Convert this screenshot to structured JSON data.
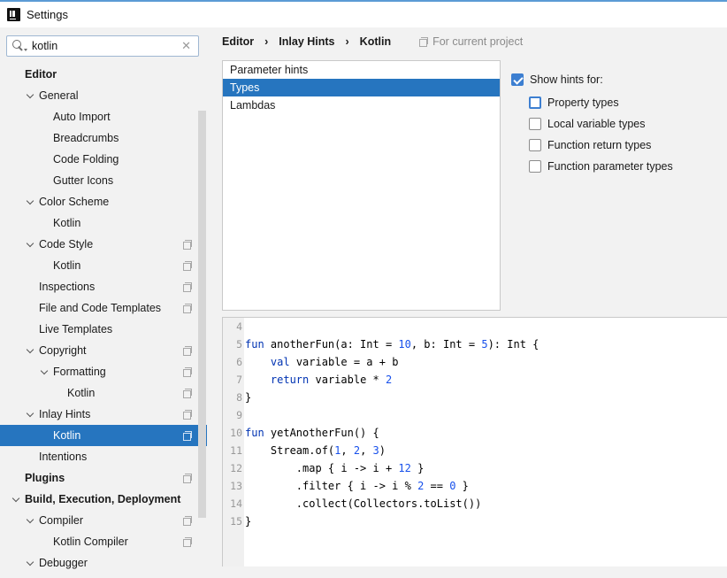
{
  "window": {
    "title": "Settings"
  },
  "search": {
    "value": "kotlin",
    "clear_glyph": "✕"
  },
  "tree": [
    {
      "label": "Editor",
      "bold": true,
      "chevron": false,
      "proj": false
    },
    {
      "label": "General",
      "bold": false,
      "chevron": true,
      "proj": false
    },
    {
      "label": "Auto Import",
      "bold": false,
      "chevron": false,
      "proj": false
    },
    {
      "label": "Breadcrumbs",
      "bold": false,
      "chevron": false,
      "proj": false
    },
    {
      "label": "Code Folding",
      "bold": false,
      "chevron": false,
      "proj": false
    },
    {
      "label": "Gutter Icons",
      "bold": false,
      "chevron": false,
      "proj": false
    },
    {
      "label": "Color Scheme",
      "bold": false,
      "chevron": true,
      "proj": false
    },
    {
      "label": "Kotlin",
      "bold": false,
      "chevron": false,
      "proj": false
    },
    {
      "label": "Code Style",
      "bold": false,
      "chevron": true,
      "proj": true
    },
    {
      "label": "Kotlin",
      "bold": false,
      "chevron": false,
      "proj": true
    },
    {
      "label": "Inspections",
      "bold": false,
      "chevron": false,
      "proj": true
    },
    {
      "label": "File and Code Templates",
      "bold": false,
      "chevron": false,
      "proj": true
    },
    {
      "label": "Live Templates",
      "bold": false,
      "chevron": false,
      "proj": false
    },
    {
      "label": "Copyright",
      "bold": false,
      "chevron": true,
      "proj": true
    },
    {
      "label": "Formatting",
      "bold": false,
      "chevron": true,
      "proj": true
    },
    {
      "label": "Kotlin",
      "bold": false,
      "chevron": false,
      "proj": true
    },
    {
      "label": "Inlay Hints",
      "bold": false,
      "chevron": true,
      "proj": true
    },
    {
      "label": "Kotlin",
      "bold": false,
      "chevron": false,
      "proj": true,
      "selected": true
    },
    {
      "label": "Intentions",
      "bold": false,
      "chevron": false,
      "proj": false
    },
    {
      "label": "Plugins",
      "bold": true,
      "chevron": false,
      "proj": true
    },
    {
      "label": "Build, Execution, Deployment",
      "bold": true,
      "chevron": true,
      "proj": false
    },
    {
      "label": "Compiler",
      "bold": false,
      "chevron": true,
      "proj": true
    },
    {
      "label": "Kotlin Compiler",
      "bold": false,
      "chevron": false,
      "proj": true
    },
    {
      "label": "Debugger",
      "bold": false,
      "chevron": true,
      "proj": false
    }
  ],
  "breadcrumb": {
    "items": [
      "Editor",
      "Inlay Hints",
      "Kotlin"
    ],
    "separator": "›",
    "for_project": "For current project"
  },
  "hint_categories": [
    {
      "label": "Parameter hints",
      "selected": false
    },
    {
      "label": "Types",
      "selected": true
    },
    {
      "label": "Lambdas",
      "selected": false
    }
  ],
  "show_hints": {
    "label": "Show hints for:",
    "checked": true
  },
  "options": [
    {
      "label": "Property types",
      "checked": false,
      "focused": true
    },
    {
      "label": "Local variable types",
      "checked": false,
      "focused": false
    },
    {
      "label": "Function return types",
      "checked": false,
      "focused": false
    },
    {
      "label": "Function parameter types",
      "checked": false,
      "focused": false
    }
  ],
  "code_lines": [
    {
      "n": "4",
      "html": ""
    },
    {
      "n": "5",
      "html": "<span class=\"kw\">fun</span> anotherFun(a: Int = <span class=\"num\">10</span>, b: Int = <span class=\"num\">5</span>): Int {"
    },
    {
      "n": "6",
      "html": "    <span class=\"kw\">val</span> variable = a + b"
    },
    {
      "n": "7",
      "html": "    <span class=\"kw\">return</span> variable * <span class=\"num\">2</span>"
    },
    {
      "n": "8",
      "html": "}"
    },
    {
      "n": "9",
      "html": ""
    },
    {
      "n": "10",
      "html": "<span class=\"kw\">fun</span> yetAnotherFun() {"
    },
    {
      "n": "11",
      "html": "    Stream.of(<span class=\"num\">1</span>, <span class=\"num\">2</span>, <span class=\"num\">3</span>)"
    },
    {
      "n": "12",
      "html": "        .map { i -> i + <span class=\"num\">12</span> }"
    },
    {
      "n": "13",
      "html": "        .filter { i -> i % <span class=\"num\">2</span> == <span class=\"num\">0</span> }"
    },
    {
      "n": "14",
      "html": "        .collect(Collectors.toList())"
    },
    {
      "n": "15",
      "html": "}"
    }
  ],
  "colors": {
    "selection": "#2675bf",
    "keyword": "#0033b3",
    "number": "#1750eb",
    "checkbox_checked": "#3d7fd1"
  }
}
